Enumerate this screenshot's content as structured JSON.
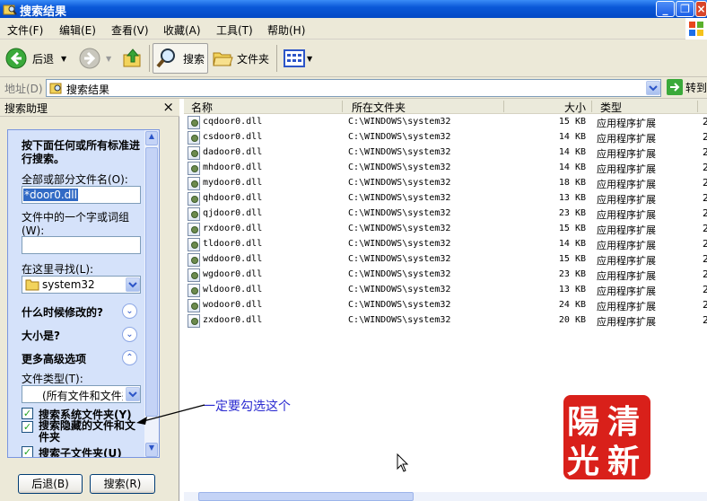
{
  "window": {
    "title": "搜索结果",
    "controls": [
      "_",
      "❐",
      "×"
    ]
  },
  "menu": {
    "items": [
      "文件(F)",
      "编辑(E)",
      "查看(V)",
      "收藏(A)",
      "工具(T)",
      "帮助(H)"
    ]
  },
  "toolbar": {
    "back": "后退",
    "search": "搜索",
    "folders": "文件夹"
  },
  "address": {
    "label": "地址(D)",
    "value": "搜索结果",
    "go": "转到"
  },
  "pane": {
    "title": "搜索助理",
    "intro": "按下面任何或所有标准进行搜索。",
    "filename_label": "全部或部分文件名(O):",
    "filename_value": "*door0.dll",
    "word_label": "文件中的一个字或词组(W):",
    "word_value": "",
    "look_in_label": "在这里寻找(L):",
    "look_in_value": "system32",
    "when_modified": "什么时候修改的?",
    "size": "大小是?",
    "advanced": "更多高级选项",
    "file_type_label": "文件类型(T):",
    "file_type_value": "(所有文件和文件夹)",
    "checkboxes": [
      "搜索系统文件夹(Y)",
      "搜索隐藏的文件和文件夹",
      "搜索子文件夹(U)"
    ],
    "back_button": "后退(B)",
    "search_button": "搜索(R)"
  },
  "list": {
    "columns": [
      "名称",
      "所在文件夹",
      "大小",
      "类型"
    ],
    "rows": [
      {
        "name": "cqdoor0.dll",
        "folder": "C:\\WINDOWS\\system32",
        "size": "15 KB",
        "type": "应用程序扩展"
      },
      {
        "name": "csdoor0.dll",
        "folder": "C:\\WINDOWS\\system32",
        "size": "14 KB",
        "type": "应用程序扩展"
      },
      {
        "name": "dadoor0.dll",
        "folder": "C:\\WINDOWS\\system32",
        "size": "14 KB",
        "type": "应用程序扩展"
      },
      {
        "name": "mhdoor0.dll",
        "folder": "C:\\WINDOWS\\system32",
        "size": "14 KB",
        "type": "应用程序扩展"
      },
      {
        "name": "mydoor0.dll",
        "folder": "C:\\WINDOWS\\system32",
        "size": "18 KB",
        "type": "应用程序扩展"
      },
      {
        "name": "qhdoor0.dll",
        "folder": "C:\\WINDOWS\\system32",
        "size": "13 KB",
        "type": "应用程序扩展"
      },
      {
        "name": "qjdoor0.dll",
        "folder": "C:\\WINDOWS\\system32",
        "size": "23 KB",
        "type": "应用程序扩展"
      },
      {
        "name": "rxdoor0.dll",
        "folder": "C:\\WINDOWS\\system32",
        "size": "15 KB",
        "type": "应用程序扩展"
      },
      {
        "name": "tldoor0.dll",
        "folder": "C:\\WINDOWS\\system32",
        "size": "14 KB",
        "type": "应用程序扩展"
      },
      {
        "name": "wddoor0.dll",
        "folder": "C:\\WINDOWS\\system32",
        "size": "15 KB",
        "type": "应用程序扩展"
      },
      {
        "name": "wgdoor0.dll",
        "folder": "C:\\WINDOWS\\system32",
        "size": "23 KB",
        "type": "应用程序扩展"
      },
      {
        "name": "wldoor0.dll",
        "folder": "C:\\WINDOWS\\system32",
        "size": "13 KB",
        "type": "应用程序扩展"
      },
      {
        "name": "wodoor0.dll",
        "folder": "C:\\WINDOWS\\system32",
        "size": "24 KB",
        "type": "应用程序扩展"
      },
      {
        "name": "zxdoor0.dll",
        "folder": "C:\\WINDOWS\\system32",
        "size": "20 KB",
        "type": "应用程序扩展"
      }
    ],
    "overflow_col": "2"
  },
  "annotation": "一定要勾选这个",
  "stamp": {
    "chars": [
      "陽",
      "清",
      "光",
      "新"
    ]
  },
  "colors": {
    "title_blue": "#0a58d8",
    "annotation_blue": "#2a2ad0",
    "stamp_red": "#d9201a"
  }
}
